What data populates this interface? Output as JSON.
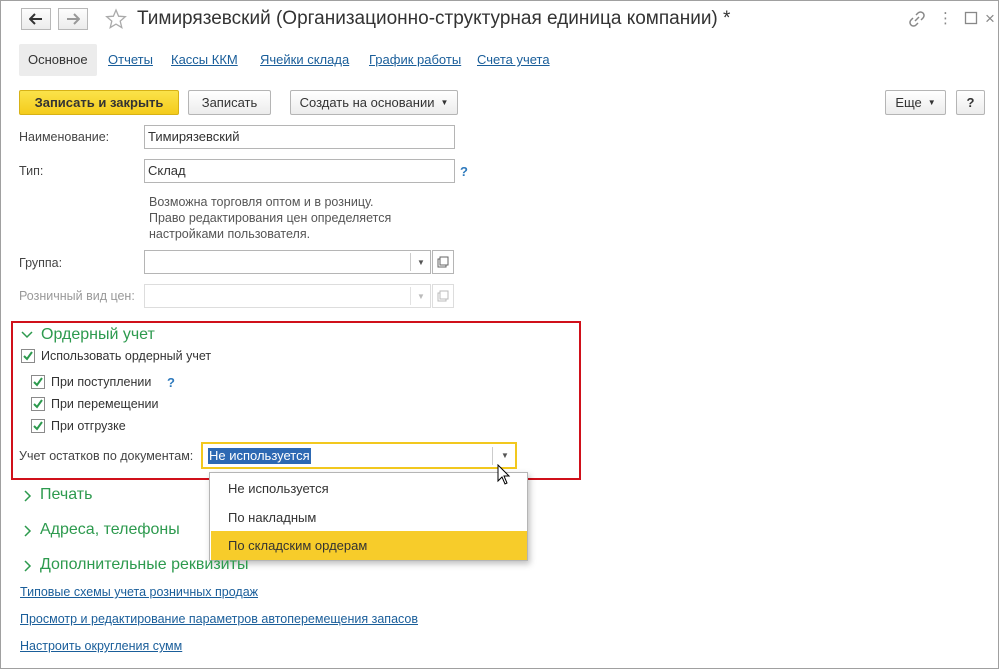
{
  "window": {
    "title": "Тимирязевский (Организационно-структурная единица компании) *"
  },
  "tabs": [
    {
      "label": "Основное",
      "active": true
    },
    {
      "label": "Отчеты"
    },
    {
      "label": "Кассы ККМ"
    },
    {
      "label": "Ячейки склада"
    },
    {
      "label": "График работы"
    },
    {
      "label": "Счета учета"
    }
  ],
  "toolbar": {
    "save_close": "Записать и закрыть",
    "save": "Записать",
    "create_based": "Создать на основании",
    "more": "Еще",
    "help": "?"
  },
  "form": {
    "name_label": "Наименование:",
    "name_value": "Тимирязевский",
    "type_label": "Тип:",
    "type_value": "Склад",
    "type_help": "?",
    "note_lines": [
      "Возможна торговля оптом и в розницу.",
      "Право редактирования цен определяется",
      "настройками пользователя."
    ],
    "group_label": "Группа:",
    "group_value": "",
    "retail_price_label": "Розничный вид цен:",
    "retail_price_value": ""
  },
  "order_accounting": {
    "title": "Ордерный учет",
    "use_label": "Использовать ордерный учет",
    "use_checked": true,
    "on_receipt_label": "При поступлении",
    "on_receipt_checked": true,
    "on_receipt_help": "?",
    "on_transfer_label": "При перемещении",
    "on_transfer_checked": true,
    "on_shipment_label": "При отгрузке",
    "on_shipment_checked": true,
    "balance_label": "Учет остатков по документам:",
    "balance_value": "Не используется",
    "options": [
      "Не используется",
      "По накладным",
      "По складским ордерам"
    ],
    "highlighted_option": "По складским ордерам"
  },
  "sections": {
    "print": "Печать",
    "addresses": "Адреса, телефоны",
    "additional": "Дополнительные реквизиты"
  },
  "links": [
    "Типовые схемы учета розничных продаж",
    "Просмотр и редактирование параметров автоперемещения запасов",
    "Настроить округления сумм"
  ],
  "colors": {
    "accent_green": "#2d9a4e",
    "highlight_red": "#d0101a",
    "primary_yellow": "#f4cc1c",
    "link_blue": "#1a5e9a"
  }
}
